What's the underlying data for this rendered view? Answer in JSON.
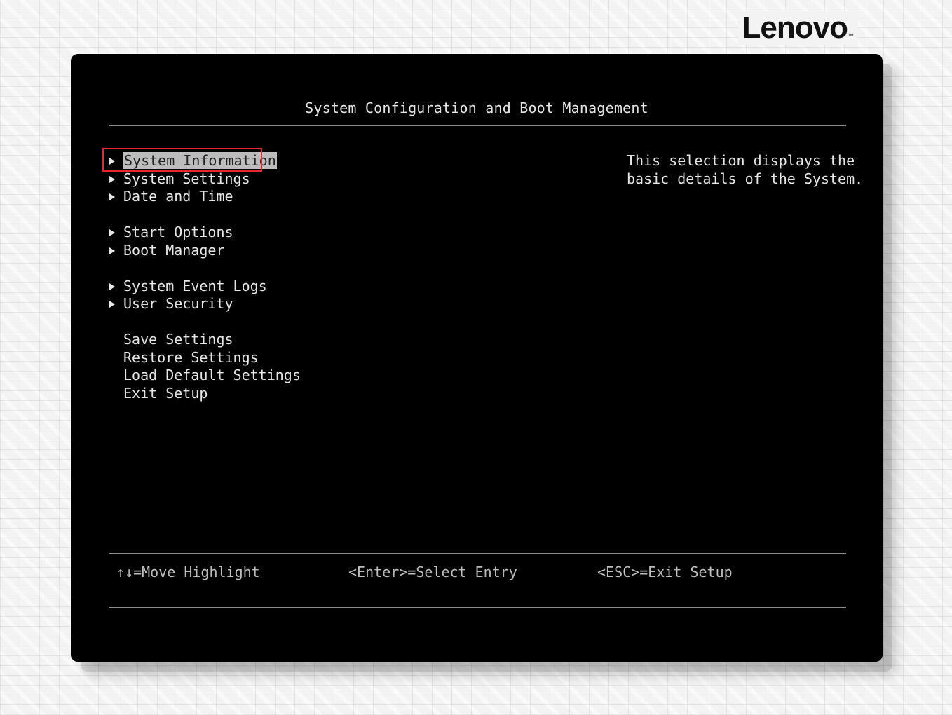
{
  "brand": {
    "logo_text": "Lenovo",
    "logo_tm": "TM"
  },
  "screen": {
    "title": "System Configuration and Boot Management",
    "menu": {
      "items": [
        {
          "label": "System Information",
          "has_submenu": true,
          "selected": true
        },
        {
          "label": "System Settings",
          "has_submenu": true
        },
        {
          "label": "Date and Time",
          "has_submenu": true
        },
        {
          "label": "Start Options",
          "has_submenu": true
        },
        {
          "label": "Boot Manager",
          "has_submenu": true
        },
        {
          "label": "System Event Logs",
          "has_submenu": true
        },
        {
          "label": "User Security",
          "has_submenu": true
        },
        {
          "label": "Save Settings",
          "has_submenu": false
        },
        {
          "label": "Restore Settings",
          "has_submenu": false
        },
        {
          "label": "Load Default Settings",
          "has_submenu": false
        },
        {
          "label": "Exit Setup",
          "has_submenu": false
        }
      ]
    },
    "help": {
      "line1": "This selection displays the",
      "line2": "basic details of the System."
    },
    "footer": {
      "move": "↑↓=Move Highlight",
      "select": "<Enter>=Select Entry",
      "exit": "<ESC>=Exit Setup"
    }
  },
  "colors": {
    "screen_bg": "#000000",
    "text": "#e6e6e6",
    "selection_bg": "#bdbdbd",
    "annotation_box": "#e8262b"
  }
}
